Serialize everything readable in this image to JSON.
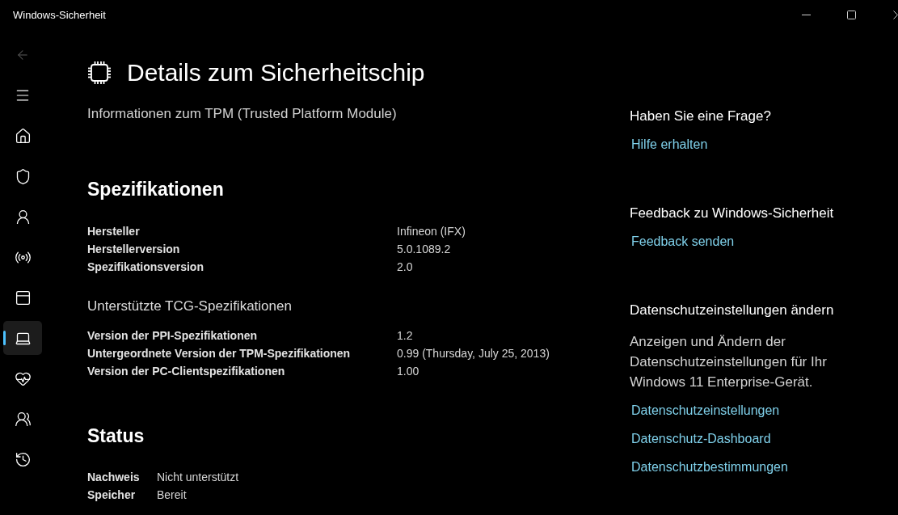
{
  "window": {
    "title": "Windows-Sicherheit"
  },
  "nav": {
    "back_button": {
      "disabled": true
    },
    "items": [
      {
        "selected": false
      },
      {
        "selected": false
      },
      {
        "selected": false
      },
      {
        "selected": false
      },
      {
        "selected": false
      },
      {
        "selected": true
      },
      {
        "selected": false
      },
      {
        "selected": false
      },
      {
        "selected": false
      }
    ]
  },
  "page": {
    "title": "Details zum Sicherheitschip",
    "subtitle": "Informationen zum TPM (Trusted Platform Module)"
  },
  "specifications": {
    "heading": "Spezifikationen",
    "rows": [
      {
        "label": "Hersteller",
        "value": "Infineon (IFX)"
      },
      {
        "label": "Herstellerversion",
        "value": "5.0.1089.2"
      },
      {
        "label": "Spezifikationsversion",
        "value": "2.0"
      }
    ],
    "tcg": {
      "title": "Unterstützte TCG-Spezifikationen",
      "rows": [
        {
          "label": "Version der PPI-Spezifikationen",
          "value": "1.2"
        },
        {
          "label": "Untergeordnete Version der TPM-Spezifikationen",
          "value": "0.99 (Thursday, July 25, 2013)"
        },
        {
          "label": "Version der PC-Clientspezifikationen",
          "value": "1.00"
        }
      ]
    }
  },
  "status": {
    "heading": "Status",
    "rows": [
      {
        "label": "Nachweis",
        "value": "Nicht unterstützt"
      },
      {
        "label": "Speicher",
        "value": "Bereit"
      }
    ]
  },
  "side_panel": {
    "sections": [
      {
        "heading": "Haben Sie eine Frage?",
        "links": [
          "Hilfe erhalten"
        ]
      },
      {
        "heading": "Feedback zu Windows-Sicherheit",
        "links": [
          "Feedback senden"
        ]
      },
      {
        "heading": "Datenschutzeinstellungen ändern",
        "text": "Anzeigen und Ändern der Datenschutzeinstellungen für Ihr Windows 11 Enterprise-Gerät.",
        "links": [
          "Datenschutzeinstellungen",
          "Datenschutz-Dashboard",
          "Datenschutzbestimmungen"
        ]
      }
    ]
  }
}
